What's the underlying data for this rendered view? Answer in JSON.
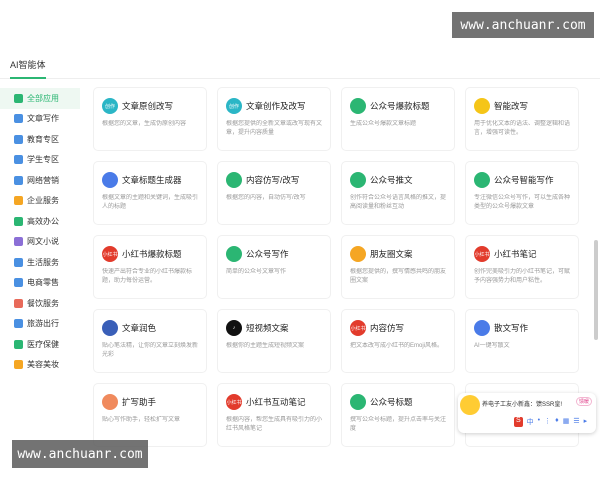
{
  "watermarks": {
    "top": "www.anchuanr.com",
    "bottom": "www.anchuanr.com"
  },
  "tabs": [
    {
      "label": "AI智能体"
    }
  ],
  "sidebar": {
    "items": [
      {
        "label": "全部应用",
        "color": "#2bb673",
        "active": true
      },
      {
        "label": "文章写作",
        "color": "#4a90e2"
      },
      {
        "label": "教育专区",
        "color": "#4a90e2"
      },
      {
        "label": "学生专区",
        "color": "#4a90e2"
      },
      {
        "label": "网络营销",
        "color": "#4a90e2"
      },
      {
        "label": "企业服务",
        "color": "#f5a623"
      },
      {
        "label": "高效办公",
        "color": "#2bb673"
      },
      {
        "label": "网文小说",
        "color": "#8b6fd6"
      },
      {
        "label": "生活服务",
        "color": "#4a90e2"
      },
      {
        "label": "电商零售",
        "color": "#4a90e2"
      },
      {
        "label": "餐饮服务",
        "color": "#e86a5a"
      },
      {
        "label": "旅游出行",
        "color": "#4a90e2"
      },
      {
        "label": "医疗保健",
        "color": "#2bb673"
      },
      {
        "label": "美容美妆",
        "color": "#f5a623"
      }
    ]
  },
  "cards": [
    {
      "title": "文章原创改写",
      "desc": "根据您的文章，生成伪原创内容",
      "icon_text": "创作",
      "icon_color": "#2bb6c6",
      "col": 0,
      "row": 0
    },
    {
      "title": "文章创作及改写",
      "desc": "根据您提供的全新文章或改写现有文章，提升内容质量",
      "icon_text": "创作",
      "icon_color": "#2bb6c6",
      "col": 1,
      "row": 0
    },
    {
      "title": "公众号爆款标题",
      "desc": "生成公众号爆款文章标题",
      "icon_text": "",
      "icon_color": "#2bb673",
      "col": 2,
      "row": 0
    },
    {
      "title": "智能改写",
      "desc": "用于优化文本的语法、调整逻辑和语言，增强可读性。",
      "icon_text": "",
      "icon_color": "#f5c518",
      "col": 3,
      "row": 0
    },
    {
      "title": "文章标题生成器",
      "desc": "根据文章的主题和关键词，生成吸引人的标题",
      "icon_text": "",
      "icon_color": "#4a7be8",
      "col": 0,
      "row": 1
    },
    {
      "title": "内容仿写/改写",
      "desc": "根据您的内容，自动仿写/改写",
      "icon_text": "",
      "icon_color": "#2bb673",
      "col": 1,
      "row": 1
    },
    {
      "title": "公众号推文",
      "desc": "创作符合公众号语言风格的推文，提高阅读量和粉丝互动",
      "icon_text": "",
      "icon_color": "#2bb673",
      "col": 2,
      "row": 1
    },
    {
      "title": "公众号智能写作",
      "desc": "专注微信公众号写作，可以生成各种类型的公众号爆款文章",
      "icon_text": "",
      "icon_color": "#2bb673",
      "col": 3,
      "row": 1
    },
    {
      "title": "小红书爆款标题",
      "desc": "快速产出符合专业的小红书爆款标题，助力每份运营。",
      "icon_text": "小红书",
      "icon_color": "#e23b2c",
      "col": 0,
      "row": 2
    },
    {
      "title": "公众号写作",
      "desc": "简单的公众号文章写作",
      "icon_text": "",
      "icon_color": "#2bb673",
      "col": 1,
      "row": 2
    },
    {
      "title": "朋友圈文案",
      "desc": "根据您提供的，撰写情感共鸣的朋友圈文案",
      "icon_text": "",
      "icon_color": "#f5a623",
      "col": 2,
      "row": 2
    },
    {
      "title": "小红书笔记",
      "desc": "创作完美吸引力的小红书笔记，可赋予内容强势力和用户粘性。",
      "icon_text": "小红书",
      "icon_color": "#e23b2c",
      "col": 3,
      "row": 2
    },
    {
      "title": "文章润色",
      "desc": "贴心笔法精，让你的文章立刻焕发新光彩",
      "icon_text": "",
      "icon_color": "#3a5fb8",
      "col": 0,
      "row": 3
    },
    {
      "title": "短视频文案",
      "desc": "根据你的主题生成短视频文案",
      "icon_text": "♪",
      "icon_color": "#111111",
      "col": 1,
      "row": 3
    },
    {
      "title": "内容仿写",
      "desc": "把文本改写成小红书的Emoji风格。",
      "icon_text": "小红书",
      "icon_color": "#e23b2c",
      "col": 2,
      "row": 3
    },
    {
      "title": "散文写作",
      "desc": "AI一键写散文",
      "icon_text": "",
      "icon_color": "#4a7be8",
      "col": 3,
      "row": 3
    },
    {
      "title": "扩写助手",
      "desc": "贴心写作助手，轻松扩写文章",
      "icon_text": "",
      "icon_color": "#f08a5d",
      "col": 0,
      "row": 4
    },
    {
      "title": "小红书互动笔记",
      "desc": "根据内容，帮您生成具有吸引力的小红书风格笔记",
      "icon_text": "小红书",
      "icon_color": "#e23b2c",
      "col": 1,
      "row": 4
    },
    {
      "title": "公众号标题",
      "desc": "撰写公众号标题，提升点击率与关注度",
      "icon_text": "",
      "icon_color": "#2bb673",
      "col": 2,
      "row": 4
    },
    {
      "title": "",
      "desc": "",
      "icon_text": "",
      "icon_color": "#e23b2c",
      "col": 3,
      "row": 4
    }
  ],
  "popup": {
    "message": "养电子工友小新鑫：馈SSR皇!",
    "tag": "馈暖",
    "toolbar": [
      "S",
      "中",
      "•",
      "⋮",
      "♦",
      "▦",
      "☰",
      "▸"
    ]
  }
}
